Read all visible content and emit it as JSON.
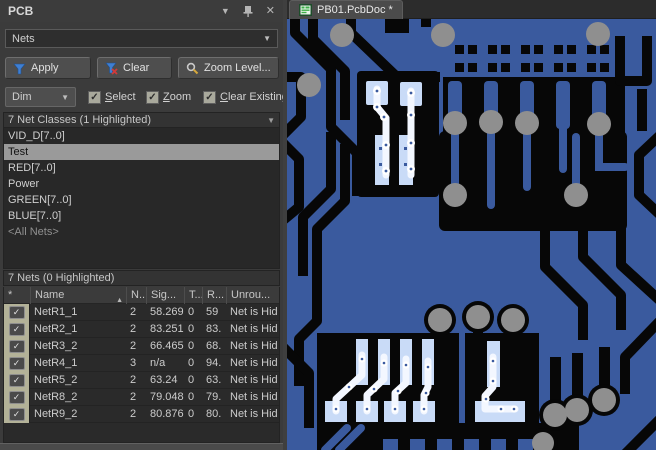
{
  "panel": {
    "title": "PCB",
    "mode_selector": {
      "value": "Nets"
    },
    "buttons": {
      "apply": "Apply",
      "clear": "Clear",
      "zoom_level": "Zoom Level..."
    },
    "dim": {
      "value": "Dim",
      "checkboxes": [
        {
          "label": "Select",
          "checked": true
        },
        {
          "label": "Zoom",
          "checked": true
        },
        {
          "label": "Clear Existing",
          "checked": true
        }
      ]
    },
    "net_classes": {
      "header": "7 Net Classes (1 Highlighted)",
      "items": [
        {
          "label": "VID_D[7..0]"
        },
        {
          "label": "Test",
          "selected": true
        },
        {
          "label": "RED[7..0]"
        },
        {
          "label": "Power"
        },
        {
          "label": "GREEN[7..0]"
        },
        {
          "label": "BLUE[7..0]"
        },
        {
          "label": "<All Nets>",
          "muted": true
        }
      ]
    },
    "nets": {
      "header": "7 Nets (0 Highlighted)",
      "columns": {
        "check": "*",
        "name": "Name",
        "nodes": "N..",
        "signal": "Sig...",
        "t": "T...",
        "routed": "R...",
        "unrouted": "Unrou..."
      },
      "rows": [
        {
          "checked": true,
          "name": "NetR1_1",
          "nodes": "2",
          "signal": "58.269",
          "t": "0",
          "routed": "59",
          "unrouted": "Net is Hid"
        },
        {
          "checked": true,
          "name": "NetR2_1",
          "nodes": "2",
          "signal": "83.251",
          "t": "0",
          "routed": "83.",
          "unrouted": "Net is Hid"
        },
        {
          "checked": true,
          "name": "NetR3_2",
          "nodes": "2",
          "signal": "66.465",
          "t": "0",
          "routed": "68.",
          "unrouted": "Net is Hid"
        },
        {
          "checked": true,
          "name": "NetR4_1",
          "nodes": "3",
          "signal": "n/a",
          "t": "0",
          "routed": "94.",
          "unrouted": "Net is Hid"
        },
        {
          "checked": true,
          "name": "NetR5_2",
          "nodes": "2",
          "signal": "63.24",
          "t": "0",
          "routed": "63.",
          "unrouted": "Net is Hid"
        },
        {
          "checked": true,
          "name": "NetR8_2",
          "nodes": "2",
          "signal": "79.048",
          "t": "0",
          "routed": "79.",
          "unrouted": "Net is Hid"
        },
        {
          "checked": true,
          "name": "NetR9_2",
          "nodes": "2",
          "signal": "80.876",
          "t": "0",
          "routed": "80.",
          "unrouted": "Net is Hid"
        }
      ]
    }
  },
  "editor": {
    "tab": {
      "label": "PB01.PcbDoc *"
    }
  },
  "colors": {
    "copper": "#3a5a9e",
    "board": "#070707",
    "via": "#8f8f8f",
    "pad-highlight": "#c9dbf7",
    "trace-highlight": "#f3f7ff",
    "selection": "#9a9a9a",
    "checkbox-strip": "#b3b298"
  }
}
